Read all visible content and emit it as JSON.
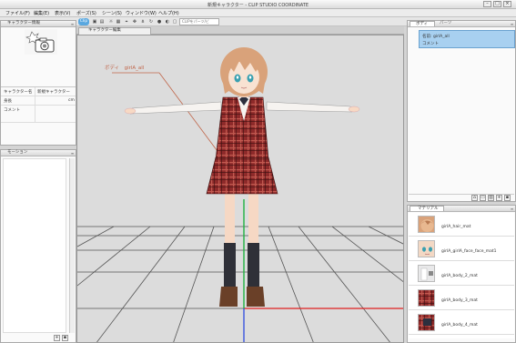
{
  "window": {
    "title": "新規キャラクター - CLIP STUDIO COORDINATE"
  },
  "menu": [
    "ファイル(F)",
    "編集(E)",
    "表示(V)",
    "ポーズ(S)",
    "シーン(S)",
    "ウィンドウ(W)",
    "ヘルプ(H)"
  ],
  "toolbar": {
    "mode_label": "Clip",
    "search_placeholder": "CLIPをパーツ/ビ"
  },
  "doc_tab": {
    "label": "キャラクター編集"
  },
  "char_panel": {
    "title": "キャラクター情報",
    "rows": [
      {
        "k": "キャラクター名",
        "v": "新規キャラクター"
      },
      {
        "k": "身長",
        "v": "",
        "unit": "cm"
      },
      {
        "k": "コメント",
        "v": ""
      }
    ]
  },
  "motion_panel": {
    "title": "モーション"
  },
  "viewport": {
    "callout_label": "ボディ　girlA_all"
  },
  "parts_panel": {
    "tab1": "ボディ",
    "tab2": "パーツ",
    "selected": {
      "name": "名前: girlA_all",
      "comment": "コメント"
    }
  },
  "material_panel": {
    "tab": "マテリアル",
    "items": [
      {
        "name": "girlA_hair_mat",
        "thumb_color": "#d9a27a"
      },
      {
        "name": "girlA_girlA_face_face_mat1",
        "thumb_color": "#f3d8c4"
      },
      {
        "name": "girlA_body_2_mat",
        "thumb_color": "#e9e9ea"
      },
      {
        "name": "girlA_body_3_mat",
        "thumb_color": "#9c3a3a"
      },
      {
        "name": "girlA_body_4_mat",
        "thumb_color": "#8a3030"
      }
    ]
  },
  "colors": {
    "accent": "#a8d0f0",
    "plaid": "#8e2a2a",
    "gridline": "#555555"
  }
}
